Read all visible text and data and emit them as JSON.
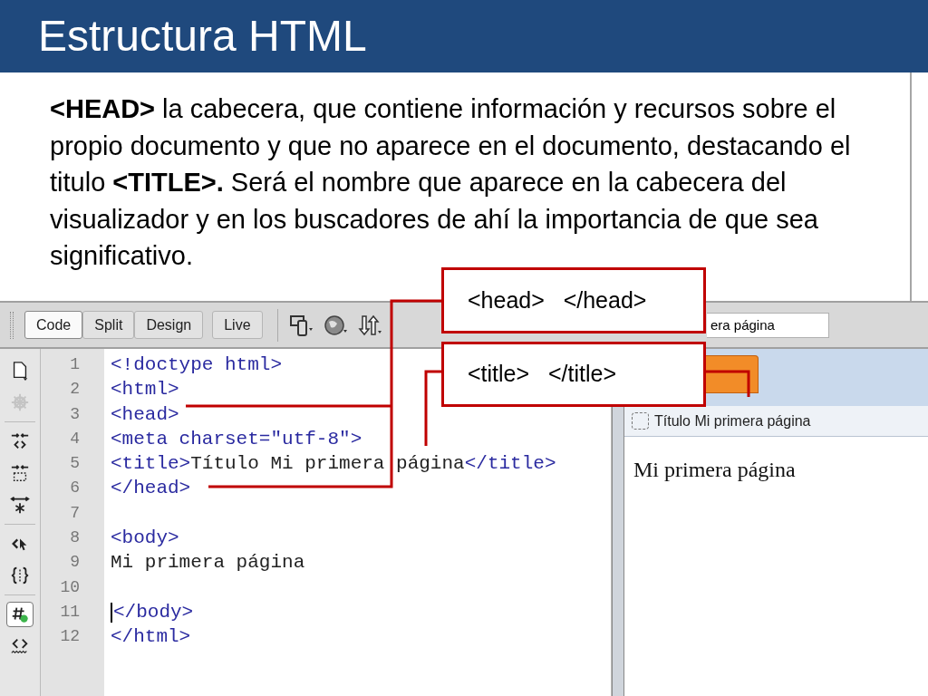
{
  "slide": {
    "title": "Estructura HTML",
    "paragraph": "**<HEAD>** la cabecera, que contiene información y recursos sobre el propio documento y que no aparece en el documento, destacando el titulo **<TITLE>.** Será el nombre que aparece en la cabecera del visualizador y en los buscadores de ahí la importancia de que sea significativo."
  },
  "toolbar": {
    "views": [
      {
        "label": "Code",
        "selected": true
      },
      {
        "label": "Split",
        "selected": false
      },
      {
        "label": "Design",
        "selected": false
      },
      {
        "label": "Live",
        "selected": false
      }
    ],
    "tools": [
      {
        "kind": "devices"
      },
      {
        "kind": "globe"
      },
      {
        "kind": "arrows"
      }
    ],
    "title_field": {
      "value": "era página"
    }
  },
  "side_tools": [
    {
      "kind": "file",
      "disabled": false,
      "selected": false
    },
    {
      "kind": "gear",
      "disabled": true,
      "selected": false
    },
    {
      "kind": "collapse-tag",
      "disabled": false,
      "selected": false
    },
    {
      "kind": "collapse-selection",
      "disabled": false,
      "selected": false
    },
    {
      "kind": "expand",
      "disabled": false,
      "selected": false
    },
    {
      "kind": "select-parent",
      "disabled": false,
      "selected": false
    },
    {
      "kind": "braces",
      "disabled": false,
      "selected": false
    },
    {
      "kind": "hash",
      "disabled": false,
      "selected": true
    },
    {
      "kind": "wrap-tag",
      "disabled": false,
      "selected": false
    }
  ],
  "code_lines": [
    {
      "number": "1",
      "cursor": false,
      "segments": [
        {
          "kind": "tag",
          "text": "<!doctype html>"
        }
      ]
    },
    {
      "number": "2",
      "cursor": false,
      "segments": [
        {
          "kind": "tag",
          "text": "<html>"
        }
      ]
    },
    {
      "number": "3",
      "cursor": false,
      "segments": [
        {
          "kind": "tag",
          "text": "<head>"
        }
      ]
    },
    {
      "number": "4",
      "cursor": false,
      "segments": [
        {
          "kind": "tag",
          "text": "<meta charset=\"utf-8\">"
        }
      ]
    },
    {
      "number": "5",
      "cursor": false,
      "segments": [
        {
          "kind": "tag",
          "text": "<title>"
        },
        {
          "kind": "text",
          "text": "Título Mi primera página"
        },
        {
          "kind": "tag",
          "text": "</title>"
        }
      ]
    },
    {
      "number": "6",
      "cursor": false,
      "segments": [
        {
          "kind": "tag",
          "text": "</head>"
        }
      ]
    },
    {
      "number": "7",
      "cursor": false
    },
    {
      "number": "8",
      "cursor": false,
      "segments": [
        {
          "kind": "tag",
          "text": "<body>"
        }
      ]
    },
    {
      "number": "9",
      "cursor": false,
      "segments": [
        {
          "kind": "text",
          "text": "Mi primera página"
        }
      ]
    },
    {
      "number": "10",
      "cursor": false
    },
    {
      "number": "11",
      "cursor": true,
      "segments": [
        {
          "kind": "tag",
          "text": "</body>"
        }
      ]
    },
    {
      "number": "12",
      "cursor": false,
      "segments": [
        {
          "kind": "tag",
          "text": "</html>"
        }
      ]
    }
  ],
  "preview": {
    "tab_title": "Título Mi primera página",
    "body_text": "Mi primera página"
  },
  "callouts": [
    {
      "text": "<head>   </head>"
    },
    {
      "text": "<title>   </title>"
    }
  ]
}
